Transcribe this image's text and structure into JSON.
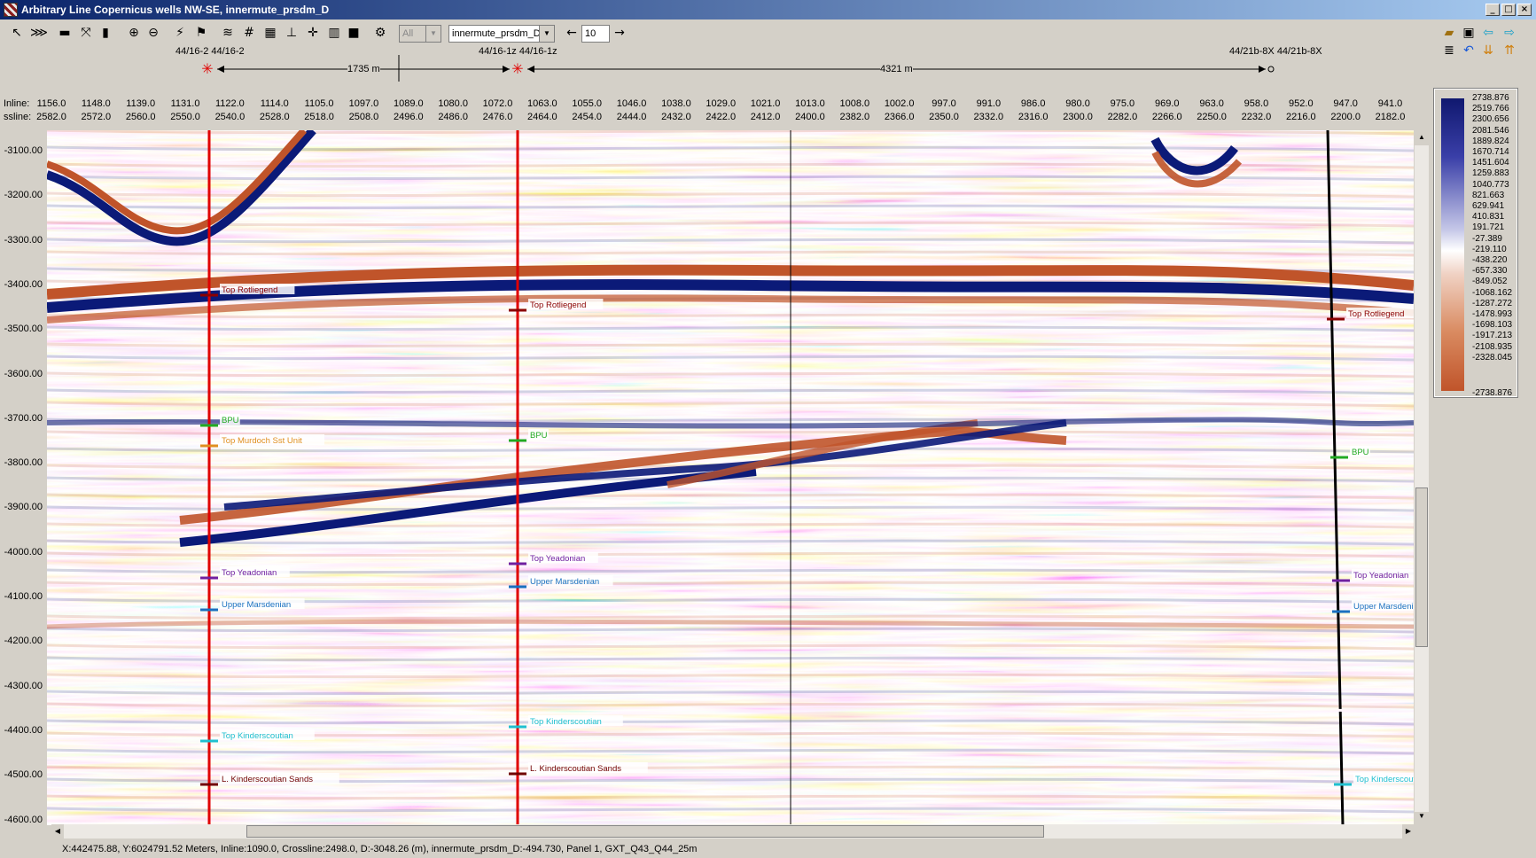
{
  "window": {
    "title": "Arbitrary Line Copernicus wells NW-SE, innermute_prsdm_D"
  },
  "toolbar": {
    "filter_combo": "All",
    "volume_combo": "innermute_prsdm_D",
    "step_value": "10"
  },
  "wells": {
    "w1_label": "44/16-2 44/16-2",
    "w2_label": "44/16-1z 44/16-1z",
    "w3_label": "44/21b-8X 44/21b-8X",
    "dist1": "1735 m",
    "dist2": "4321 m"
  },
  "axes": {
    "inline_label": "Inline:",
    "crossline_label": "ssline:",
    "inline_ticks": [
      "1156.0",
      "1148.0",
      "1139.0",
      "1131.0",
      "1122.0",
      "1114.0",
      "1105.0",
      "1097.0",
      "1089.0",
      "1080.0",
      "1072.0",
      "1063.0",
      "1055.0",
      "1046.0",
      "1038.0",
      "1029.0",
      "1021.0",
      "1013.0",
      "1008.0",
      "1002.0",
      "997.0",
      "991.0",
      "986.0",
      "980.0",
      "975.0",
      "969.0",
      "963.0",
      "958.0",
      "952.0",
      "947.0",
      "941.0"
    ],
    "crossline_ticks": [
      "2582.0",
      "2572.0",
      "2560.0",
      "2550.0",
      "2540.0",
      "2528.0",
      "2518.0",
      "2508.0",
      "2496.0",
      "2486.0",
      "2476.0",
      "2464.0",
      "2454.0",
      "2444.0",
      "2432.0",
      "2422.0",
      "2412.0",
      "2400.0",
      "2382.0",
      "2366.0",
      "2350.0",
      "2332.0",
      "2316.0",
      "2300.0",
      "2282.0",
      "2266.0",
      "2250.0",
      "2232.0",
      "2216.0",
      "2200.0",
      "2182.0"
    ],
    "depth_ticks": [
      "-3100.00",
      "-3200.00",
      "-3300.00",
      "-3400.00",
      "-3500.00",
      "-3600.00",
      "-3700.00",
      "-3800.00",
      "-3900.00",
      "-4000.00",
      "-4100.00",
      "-4200.00",
      "-4300.00",
      "-4400.00",
      "-4500.00",
      "-4600.00"
    ]
  },
  "legend": {
    "values": [
      "2738.876",
      "2519.766",
      "2300.656",
      "2081.546",
      "1889.824",
      "1670.714",
      "1451.604",
      "1259.883",
      "1040.773",
      "821.663",
      "629.941",
      "410.831",
      "191.721",
      "-27.389",
      "-219.110",
      "-438.220",
      "-657.330",
      "-849.052",
      "-1068.162",
      "-1287.272",
      "-1478.993",
      "-1698.103",
      "-1917.213",
      "-2108.935",
      "-2328.045",
      "-2738.876"
    ]
  },
  "markers": {
    "rotliegend": "Top Rotliegend",
    "bpu": "BPU",
    "murdoch": "Top Murdoch Sst Unit",
    "yeadonian": "Top Yeadonian",
    "marsdenian": "Upper Marsdenian",
    "kinderscoutian": "Top Kinderscoutian",
    "l_kinderscoutian": "L. Kinderscoutian Sands"
  },
  "status": {
    "text": "X:442475.88, Y:6024791.52 Meters,   Inline:1090.0,   Crossline:2498.0,   D:-3048.26 (m),   innermute_prsdm_D:-494.730,   Panel 1,   GXT_Q43_Q44_25m"
  },
  "colors": {
    "blue": "#0b1a78",
    "orange": "#c0542a",
    "well": "#e00000"
  }
}
